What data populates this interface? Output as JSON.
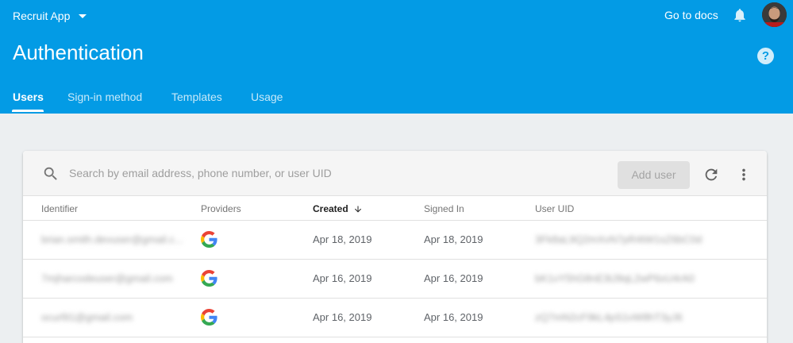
{
  "header": {
    "project_name": "Recruit App",
    "docs_link": "Go to docs",
    "page_title": "Authentication",
    "help_symbol": "?"
  },
  "tabs": [
    {
      "label": "Users",
      "active": true
    },
    {
      "label": "Sign-in method",
      "active": false
    },
    {
      "label": "Templates",
      "active": false
    },
    {
      "label": "Usage",
      "active": false
    }
  ],
  "toolbar": {
    "search_placeholder": "Search by email address, phone number, or user UID",
    "add_user_label": "Add user"
  },
  "table": {
    "columns": [
      "Identifier",
      "Providers",
      "Created",
      "Signed In",
      "User UID"
    ],
    "sorted_column": "Created",
    "rows": [
      {
        "identifier": "brian.smith.devuser@gmail.c...",
        "provider": "google",
        "created": "Apr 18, 2019",
        "signed_in": "Apr 18, 2019",
        "uid": "3Fk8aL9Q2mXvN7pR4tW1sZ6bC0d"
      },
      {
        "identifier": "7mjharcodeuser@gmail.com",
        "provider": "google",
        "created": "Apr 16, 2019",
        "signed_in": "Apr 16, 2019",
        "uid": "bK1vY5hG8nE3tJ9qL2wP6xU4rA0"
      },
      {
        "identifier": "ocurl91@gmail.com",
        "provider": "google",
        "created": "Apr 16, 2019",
        "signed_in": "Apr 16, 2019",
        "uid": "zQ7mN2cF9kL4pS1vW8hT3yJ6"
      }
    ]
  },
  "colors": {
    "header_bg": "#039be5",
    "page_bg": "#eceff1",
    "google_blue": "#4285f4",
    "google_red": "#ea4335",
    "google_yellow": "#fbbc05",
    "google_green": "#34a853"
  },
  "icons": {
    "project_caret": "chevron-down-icon",
    "notifications": "bell-icon",
    "help": "help-icon",
    "search": "search-icon",
    "refresh": "refresh-icon",
    "more": "more-vert-icon",
    "sort": "arrow-down-icon",
    "provider": "google-icon"
  }
}
